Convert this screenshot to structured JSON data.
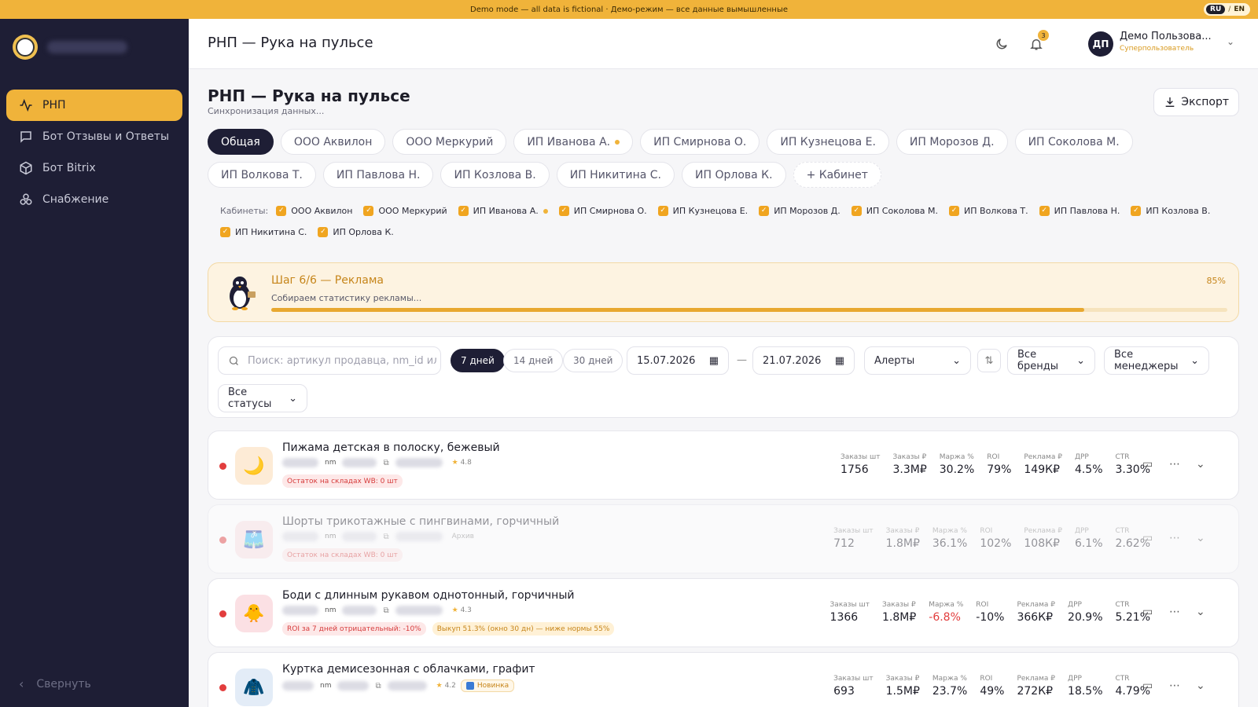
{
  "banner": {
    "text": "Demo mode — all data is fictional · Демо-режим — все данные вымышленные",
    "lang_active": "RU",
    "lang_other": "EN"
  },
  "sidebar": {
    "items": [
      {
        "label": "РНП",
        "icon": "activity-icon"
      },
      {
        "label": "Бот Отзывы и Ответы",
        "icon": "message-square-icon"
      },
      {
        "label": "Бот Bitrix",
        "icon": "cube-icon"
      },
      {
        "label": "Снабжение",
        "icon": "boxes-icon"
      }
    ],
    "collapse_label": "Свернуть"
  },
  "header": {
    "title": "РНП — Рука на пульсе",
    "notifications": "3",
    "avatar": "ДП",
    "user_name": "Демо Пользова...",
    "user_role": "Суперпользователь"
  },
  "page": {
    "title": "РНП — Рука на пульсе",
    "subtitle": "Синхронизация данных...",
    "export_label": "Экспорт"
  },
  "tabs": [
    "Общая",
    "ООО Аквилон",
    "ООО Меркурий",
    "ИП Иванова А.",
    "ИП Смирнова О.",
    "ИП Кузнецова Е.",
    "ИП Морозов Д.",
    "ИП Соколова М.",
    "ИП Волкова Т.",
    "ИП Павлова Н.",
    "ИП Козлова В.",
    "ИП Никитина С.",
    "ИП Орлова К.",
    "+ Кабинет"
  ],
  "cabinets": {
    "label": "Кабинеты:",
    "items": [
      "ООО Аквилон",
      "ООО Меркурий",
      "ИП Иванова А.",
      "ИП Смирнова О.",
      "ИП Кузнецова Е.",
      "ИП Морозов Д.",
      "ИП Соколова М.",
      "ИП Волкова Т.",
      "ИП Павлова Н.",
      "ИП Козлова В.",
      "ИП Никитина С.",
      "ИП Орлова К."
    ]
  },
  "progress": {
    "step": "Шаг 6/6 — Реклама",
    "subtitle": "Собираем статистику рекламы...",
    "percent_label": "85%",
    "fraction": 0.85
  },
  "filters": {
    "search_placeholder": "Поиск: артикул продавца, nm_id или",
    "periods": [
      "7 дней",
      "14 дней",
      "30 дней"
    ],
    "date_from": "15.07.2026",
    "date_to": "21.07.2026",
    "dash": "—",
    "alerts": "Алерты",
    "brands": "Все бренды",
    "managers": "Все менеджеры",
    "statuses": "Все статусы"
  },
  "metric_labels": [
    "Заказы шт",
    "Заказы ₽",
    "Маржа %",
    "ROI",
    "Реклама ₽",
    "ДРР",
    "CTR"
  ],
  "products": [
    {
      "name": "Пижама детская в полоску, бежевый",
      "nm": "nm",
      "rating": "4.8",
      "extra": "",
      "thumb": "🌙",
      "thumb_bg": "#fdebd6",
      "tags": [
        {
          "text": "Остаток на складах WB: 0 шт",
          "kind": "red"
        }
      ],
      "values": [
        "1756",
        "3.3М₽",
        "30.2%",
        "79%",
        "149К₽",
        "4.5%",
        "3.30%"
      ],
      "neg": []
    },
    {
      "name": "Шорты трикотажные с пингвинами, горчичный",
      "nm": "nm",
      "rating": "",
      "extra": "Архив",
      "thumb": "🩳",
      "thumb_bg": "#fbe0e4",
      "tags": [
        {
          "text": "Остаток на складах WB: 0 шт",
          "kind": "red"
        }
      ],
      "values": [
        "712",
        "1.8М₽",
        "36.1%",
        "102%",
        "108К₽",
        "6.1%",
        "2.62%"
      ],
      "neg": []
    },
    {
      "name": "Боди с длинным рукавом однотонный, горчичный",
      "nm": "nm",
      "rating": "4.3",
      "extra": "",
      "thumb": "🐥",
      "thumb_bg": "#fbe0e4",
      "tags": [
        {
          "text": "ROI за 7 дней отрицательный: -10%",
          "kind": "red"
        },
        {
          "text": "Выкуп 51.3% (окно 30 дн) — ниже нормы 55%",
          "kind": "yel"
        }
      ],
      "values": [
        "1366",
        "1.8М₽",
        "-6.8%",
        "-10%",
        "366К₽",
        "20.9%",
        "5.21%"
      ],
      "neg": [
        2
      ]
    },
    {
      "name": "Куртка демисезонная с облачками, графит",
      "nm": "nm",
      "rating": "4.2",
      "extra": "",
      "new_badge": "Новинка",
      "thumb": "🧥",
      "thumb_bg": "#e3ecf7",
      "tags": [],
      "values": [
        "693",
        "1.5М₽",
        "23.7%",
        "49%",
        "272К₽",
        "18.5%",
        "4.79%"
      ],
      "neg": []
    }
  ],
  "colors": {
    "accent": "#f0b33a",
    "sidebar": "#1e1e35",
    "danger": "#e23d3d"
  }
}
